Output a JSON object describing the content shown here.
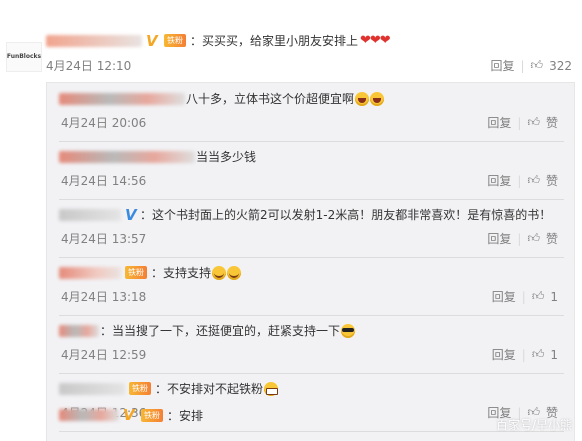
{
  "top_comment": {
    "avatar_text": "FunBlocks",
    "text": "：买买买，给家里小朋友安排上",
    "hearts": "❤❤❤",
    "time": "4月24日 12:10",
    "reply_label": "回复",
    "like_count": "322"
  },
  "replies": [
    {
      "text": "八十多，立体书这个价超便宜啊",
      "time": "4月24日 20:06",
      "reply_label": "回复",
      "like_label": "赞"
    },
    {
      "text": "当当多少钱",
      "time": "4月24日 14:56",
      "reply_label": "回复",
      "like_label": "赞"
    },
    {
      "text": "：这个书封面上的火箭2可以发射1-2米高！朋友都非常喜欢！是有惊喜的书！",
      "time": "4月24日 13:57",
      "reply_label": "回复",
      "like_label": "赞"
    },
    {
      "text": "：支持支持",
      "time": "4月24日 13:18",
      "reply_label": "回复",
      "like_label": "1"
    },
    {
      "text": "：当当搜了一下，还挺便宜的，赶紧支持一下",
      "time": "4月24日 12:59",
      "reply_label": "回复",
      "like_label": "1"
    },
    {
      "text": "：不安排对不起铁粉",
      "time": "4月24日 12:36",
      "reply_label": "回复",
      "like_label": "赞"
    },
    {
      "text": "：安排",
      "time": "",
      "reply_label": "",
      "like_label": ""
    }
  ],
  "fan_badge": "铁粉",
  "watermark": "百家号/早小熊",
  "colors": {
    "username": "#eb7350",
    "verified_gold": "#f5a623",
    "verified_blue": "#3a8be0",
    "reply_bg": "#f2f2f5",
    "meta": "#808080"
  },
  "icons": {
    "like": "thumbs-up-icon",
    "verified": "verified-v-icon"
  }
}
